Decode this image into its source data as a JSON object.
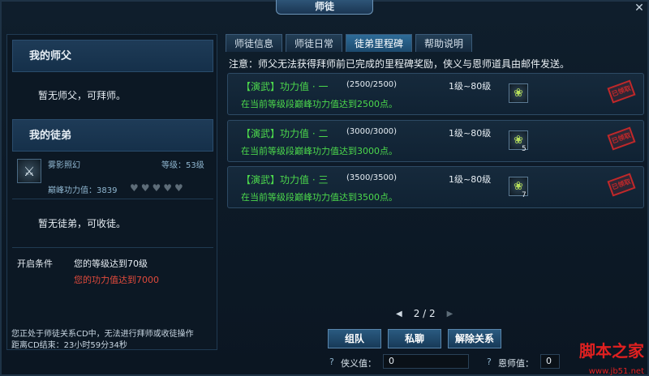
{
  "window": {
    "title": "师徒",
    "close_icon": "✕"
  },
  "left_panel": {
    "master_section": {
      "header": "我的师父",
      "status": "暂无师父，可拜师。"
    },
    "disciple_section": {
      "header": "我的徒弟",
      "disciple": {
        "name": "雾影照幻",
        "level_label": "等级：53级",
        "power_label": "巅峰功力值：3839",
        "hearts": "♥♥♥♥♥"
      },
      "status": "暂无徒弟，可收徒。"
    },
    "open_conditions": {
      "label": "开启条件",
      "condition_1": "您的等级达到70级",
      "condition_2": "您的功力值达到7000"
    },
    "cd_notice_1": "您正处于师徒关系CD中，无法进行拜师或收徒操作",
    "cd_notice_2": "距离CD结束：23小时59分34秒"
  },
  "tabs": [
    "师徒信息",
    "师徒日常",
    "徒弟里程碑",
    "帮助说明"
  ],
  "active_tab": "徒弟里程碑",
  "notice": "注意：师父无法获得拜师前已完成的里程碑奖励，侠义与恩师道具由邮件发送。",
  "milestones": [
    {
      "name": "【演武】功力值 · 一",
      "progress": "(2500/2500)",
      "desc": "在当前等级段巅峰功力值达到2500点。",
      "level": "1级~80级",
      "reward_count": "",
      "stamp": "已领取"
    },
    {
      "name": "【演武】功力值 · 二",
      "progress": "(3000/3000)",
      "desc": "在当前等级段巅峰功力值达到3000点。",
      "level": "1级~80级",
      "reward_count": "5",
      "stamp": "已领取"
    },
    {
      "name": "【演武】功力值 · 三",
      "progress": "(3500/3500)",
      "desc": "在当前等级段巅峰功力值达到3500点。",
      "level": "1级~80级",
      "reward_count": "7",
      "stamp": "已领取"
    }
  ],
  "pager": {
    "text": "2 / 2"
  },
  "buttons": {
    "team": "组队",
    "whisper": "私聊",
    "dissolve": "解除关系"
  },
  "stats": {
    "chivalry_label": "侠义值：",
    "chivalry_value": "0",
    "mentor_label": "恩师值：",
    "mentor_value": "0"
  },
  "watermark": {
    "text": "脚本之家",
    "url": "www.jb51.net"
  }
}
